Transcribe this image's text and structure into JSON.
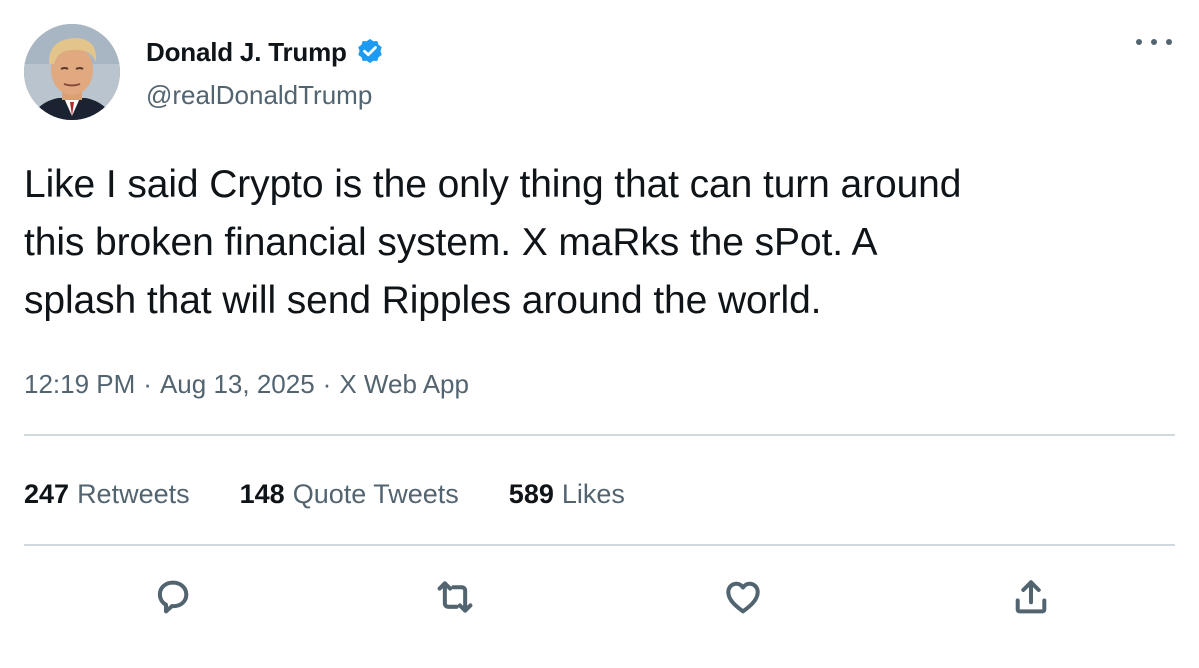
{
  "author": {
    "display_name": "Donald J. Trump",
    "handle": "@realDonaldTrump",
    "verified": true,
    "verified_color": "#1d9bf0",
    "avatar_icon": "profile-photo"
  },
  "tweet": {
    "text_lines": [
      "Like I said Crypto is the only thing that can turn around",
      "this broken financial system. X maRks the sPot. A",
      "splash that will send Ripples around the world."
    ]
  },
  "meta": {
    "time": "12:19 PM",
    "date": "Aug 13, 2025",
    "source": "X Web App",
    "separator": "·"
  },
  "stats": [
    {
      "count": "247",
      "label": "Retweets"
    },
    {
      "count": "148",
      "label": "Quote Tweets"
    },
    {
      "count": "589",
      "label": "Likes"
    }
  ],
  "actions": [
    {
      "icon": "reply-icon"
    },
    {
      "icon": "retweet-icon"
    },
    {
      "icon": "like-icon"
    },
    {
      "icon": "share-icon"
    }
  ],
  "colors": {
    "text_primary": "#0f1419",
    "text_secondary": "#536471",
    "divider": "#cfd9de",
    "accent": "#1d9bf0"
  }
}
